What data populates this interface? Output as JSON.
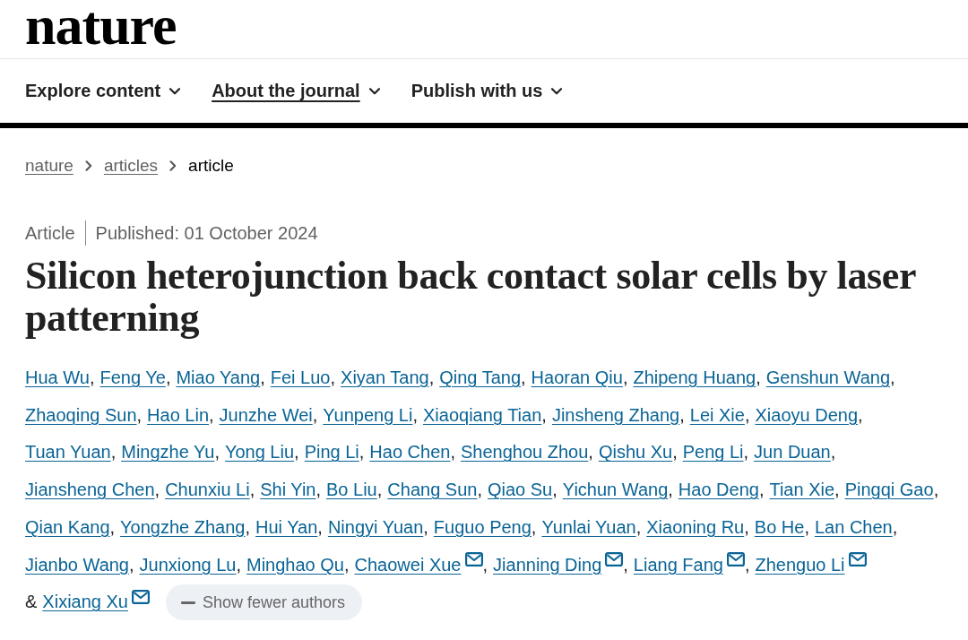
{
  "logo": "nature",
  "nav": [
    {
      "label": "Explore content",
      "hovered": false
    },
    {
      "label": "About the journal",
      "hovered": true
    },
    {
      "label": "Publish with us",
      "hovered": false
    }
  ],
  "breadcrumb": [
    {
      "label": "nature",
      "kind": "link"
    },
    {
      "label": "articles",
      "kind": "link"
    },
    {
      "label": "article",
      "kind": "current"
    }
  ],
  "article": {
    "type": "Article",
    "published": "Published: 01 October 2024",
    "title": "Silicon heterojunction back contact solar cells by laser patterning"
  },
  "authors": {
    "list": [
      {
        "name": "Hua Wu",
        "corresponding": false,
        "separator": ","
      },
      {
        "name": "Feng Ye",
        "corresponding": false,
        "separator": ","
      },
      {
        "name": "Miao Yang",
        "corresponding": false,
        "separator": ","
      },
      {
        "name": "Fei Luo",
        "corresponding": false,
        "separator": ","
      },
      {
        "name": "Xiyan Tang",
        "corresponding": false,
        "separator": ","
      },
      {
        "name": "Qing Tang",
        "corresponding": false,
        "separator": ","
      },
      {
        "name": "Haoran Qiu",
        "corresponding": false,
        "separator": ","
      },
      {
        "name": "Zhipeng Huang",
        "corresponding": false,
        "separator": ","
      },
      {
        "name": "Genshun Wang",
        "corresponding": false,
        "separator": ","
      },
      {
        "name": "Zhaoqing Sun",
        "corresponding": false,
        "separator": ","
      },
      {
        "name": "Hao Lin",
        "corresponding": false,
        "separator": ","
      },
      {
        "name": "Junzhe Wei",
        "corresponding": false,
        "separator": ","
      },
      {
        "name": "Yunpeng Li",
        "corresponding": false,
        "separator": ","
      },
      {
        "name": "Xiaoqiang Tian",
        "corresponding": false,
        "separator": ","
      },
      {
        "name": "Jinsheng Zhang",
        "corresponding": false,
        "separator": ","
      },
      {
        "name": "Lei Xie",
        "corresponding": false,
        "separator": ","
      },
      {
        "name": "Xiaoyu Deng",
        "corresponding": false,
        "separator": ","
      },
      {
        "name": "Tuan Yuan",
        "corresponding": false,
        "separator": ","
      },
      {
        "name": "Mingzhe Yu",
        "corresponding": false,
        "separator": ","
      },
      {
        "name": "Yong Liu",
        "corresponding": false,
        "separator": ","
      },
      {
        "name": "Ping Li",
        "corresponding": false,
        "separator": ","
      },
      {
        "name": "Hao Chen",
        "corresponding": false,
        "separator": ","
      },
      {
        "name": "Shenghou Zhou",
        "corresponding": false,
        "separator": ","
      },
      {
        "name": "Qishu Xu",
        "corresponding": false,
        "separator": ","
      },
      {
        "name": "Peng Li",
        "corresponding": false,
        "separator": ","
      },
      {
        "name": "Jun Duan",
        "corresponding": false,
        "separator": ","
      },
      {
        "name": "Jiansheng Chen",
        "corresponding": false,
        "separator": ","
      },
      {
        "name": "Chunxiu Li",
        "corresponding": false,
        "separator": ","
      },
      {
        "name": "Shi Yin",
        "corresponding": false,
        "separator": ","
      },
      {
        "name": "Bo Liu",
        "corresponding": false,
        "separator": ","
      },
      {
        "name": "Chang Sun",
        "corresponding": false,
        "separator": ","
      },
      {
        "name": "Qiao Su",
        "corresponding": false,
        "separator": ","
      },
      {
        "name": "Yichun Wang",
        "corresponding": false,
        "separator": ","
      },
      {
        "name": "Hao Deng",
        "corresponding": false,
        "separator": ","
      },
      {
        "name": "Tian Xie",
        "corresponding": false,
        "separator": ","
      },
      {
        "name": "Pingqi Gao",
        "corresponding": false,
        "separator": ","
      },
      {
        "name": "Qian Kang",
        "corresponding": false,
        "separator": ","
      },
      {
        "name": "Yongzhe Zhang",
        "corresponding": false,
        "separator": ","
      },
      {
        "name": "Hui Yan",
        "corresponding": false,
        "separator": ","
      },
      {
        "name": "Ningyi Yuan",
        "corresponding": false,
        "separator": ","
      },
      {
        "name": "Fuguo Peng",
        "corresponding": false,
        "separator": ","
      },
      {
        "name": "Yunlai Yuan",
        "corresponding": false,
        "separator": ","
      },
      {
        "name": "Xiaoning Ru",
        "corresponding": false,
        "separator": ","
      },
      {
        "name": "Bo He",
        "corresponding": false,
        "separator": ","
      },
      {
        "name": "Lan Chen",
        "corresponding": false,
        "separator": ","
      },
      {
        "name": "Jianbo Wang",
        "corresponding": false,
        "separator": ","
      },
      {
        "name": "Junxiong Lu",
        "corresponding": false,
        "separator": ","
      },
      {
        "name": "Minghao Qu",
        "corresponding": false,
        "separator": ","
      },
      {
        "name": "Chaowei Xue",
        "corresponding": true,
        "separator": ","
      },
      {
        "name": "Jianning Ding",
        "corresponding": true,
        "separator": ","
      },
      {
        "name": "Liang Fang",
        "corresponding": true,
        "separator": ","
      },
      {
        "name": "Zhenguo Li",
        "corresponding": true
      },
      {
        "name": "Xixiang Xu",
        "corresponding": true,
        "conjunction": "&"
      }
    ],
    "toggle": {
      "label": "Show fewer authors"
    }
  }
}
